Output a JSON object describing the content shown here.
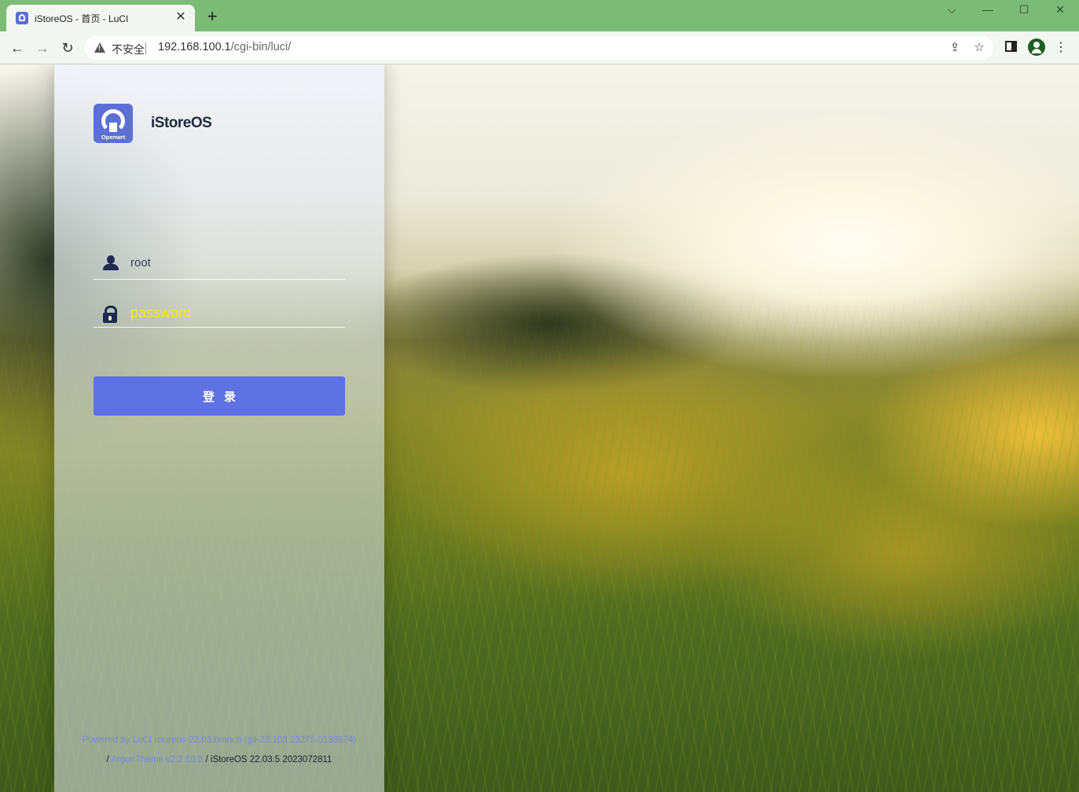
{
  "browser": {
    "tab_title": "iStoreOS - 首页 - LuCI",
    "tab_close": "✕",
    "new_tab": "+",
    "window_controls": {
      "dropdown": "⌵",
      "minimize": "—",
      "maximize": "☐",
      "close": "✕"
    },
    "back": "←",
    "forward": "→",
    "reload": "↻",
    "security_label": "不安全",
    "url_host": "192.168.100.1",
    "url_path": "/cgi-bin/luci/",
    "icons": [
      "share-icon",
      "star-icon",
      "side-panel-icon",
      "profile-icon",
      "menu-icon"
    ],
    "menu": "⋮",
    "share": "⇪",
    "star": "☆",
    "theme_color": "#7cbb77"
  },
  "login": {
    "brand": "iStoreOS",
    "logo_text": "Openwrt",
    "username_value": "root",
    "password_placeholder": "password",
    "submit_label": "登录",
    "accent_color": "#5e72e4"
  },
  "footer": {
    "powered_by": "Powered by LuCI istoreos-22.03 branch (git-23.103.23275-0193674)",
    "slash1": "/",
    "theme_link": "ArgonTheme v2.2.10.8",
    "slash2": "/",
    "version": "iStoreOS 22.03.5 2023072811"
  }
}
